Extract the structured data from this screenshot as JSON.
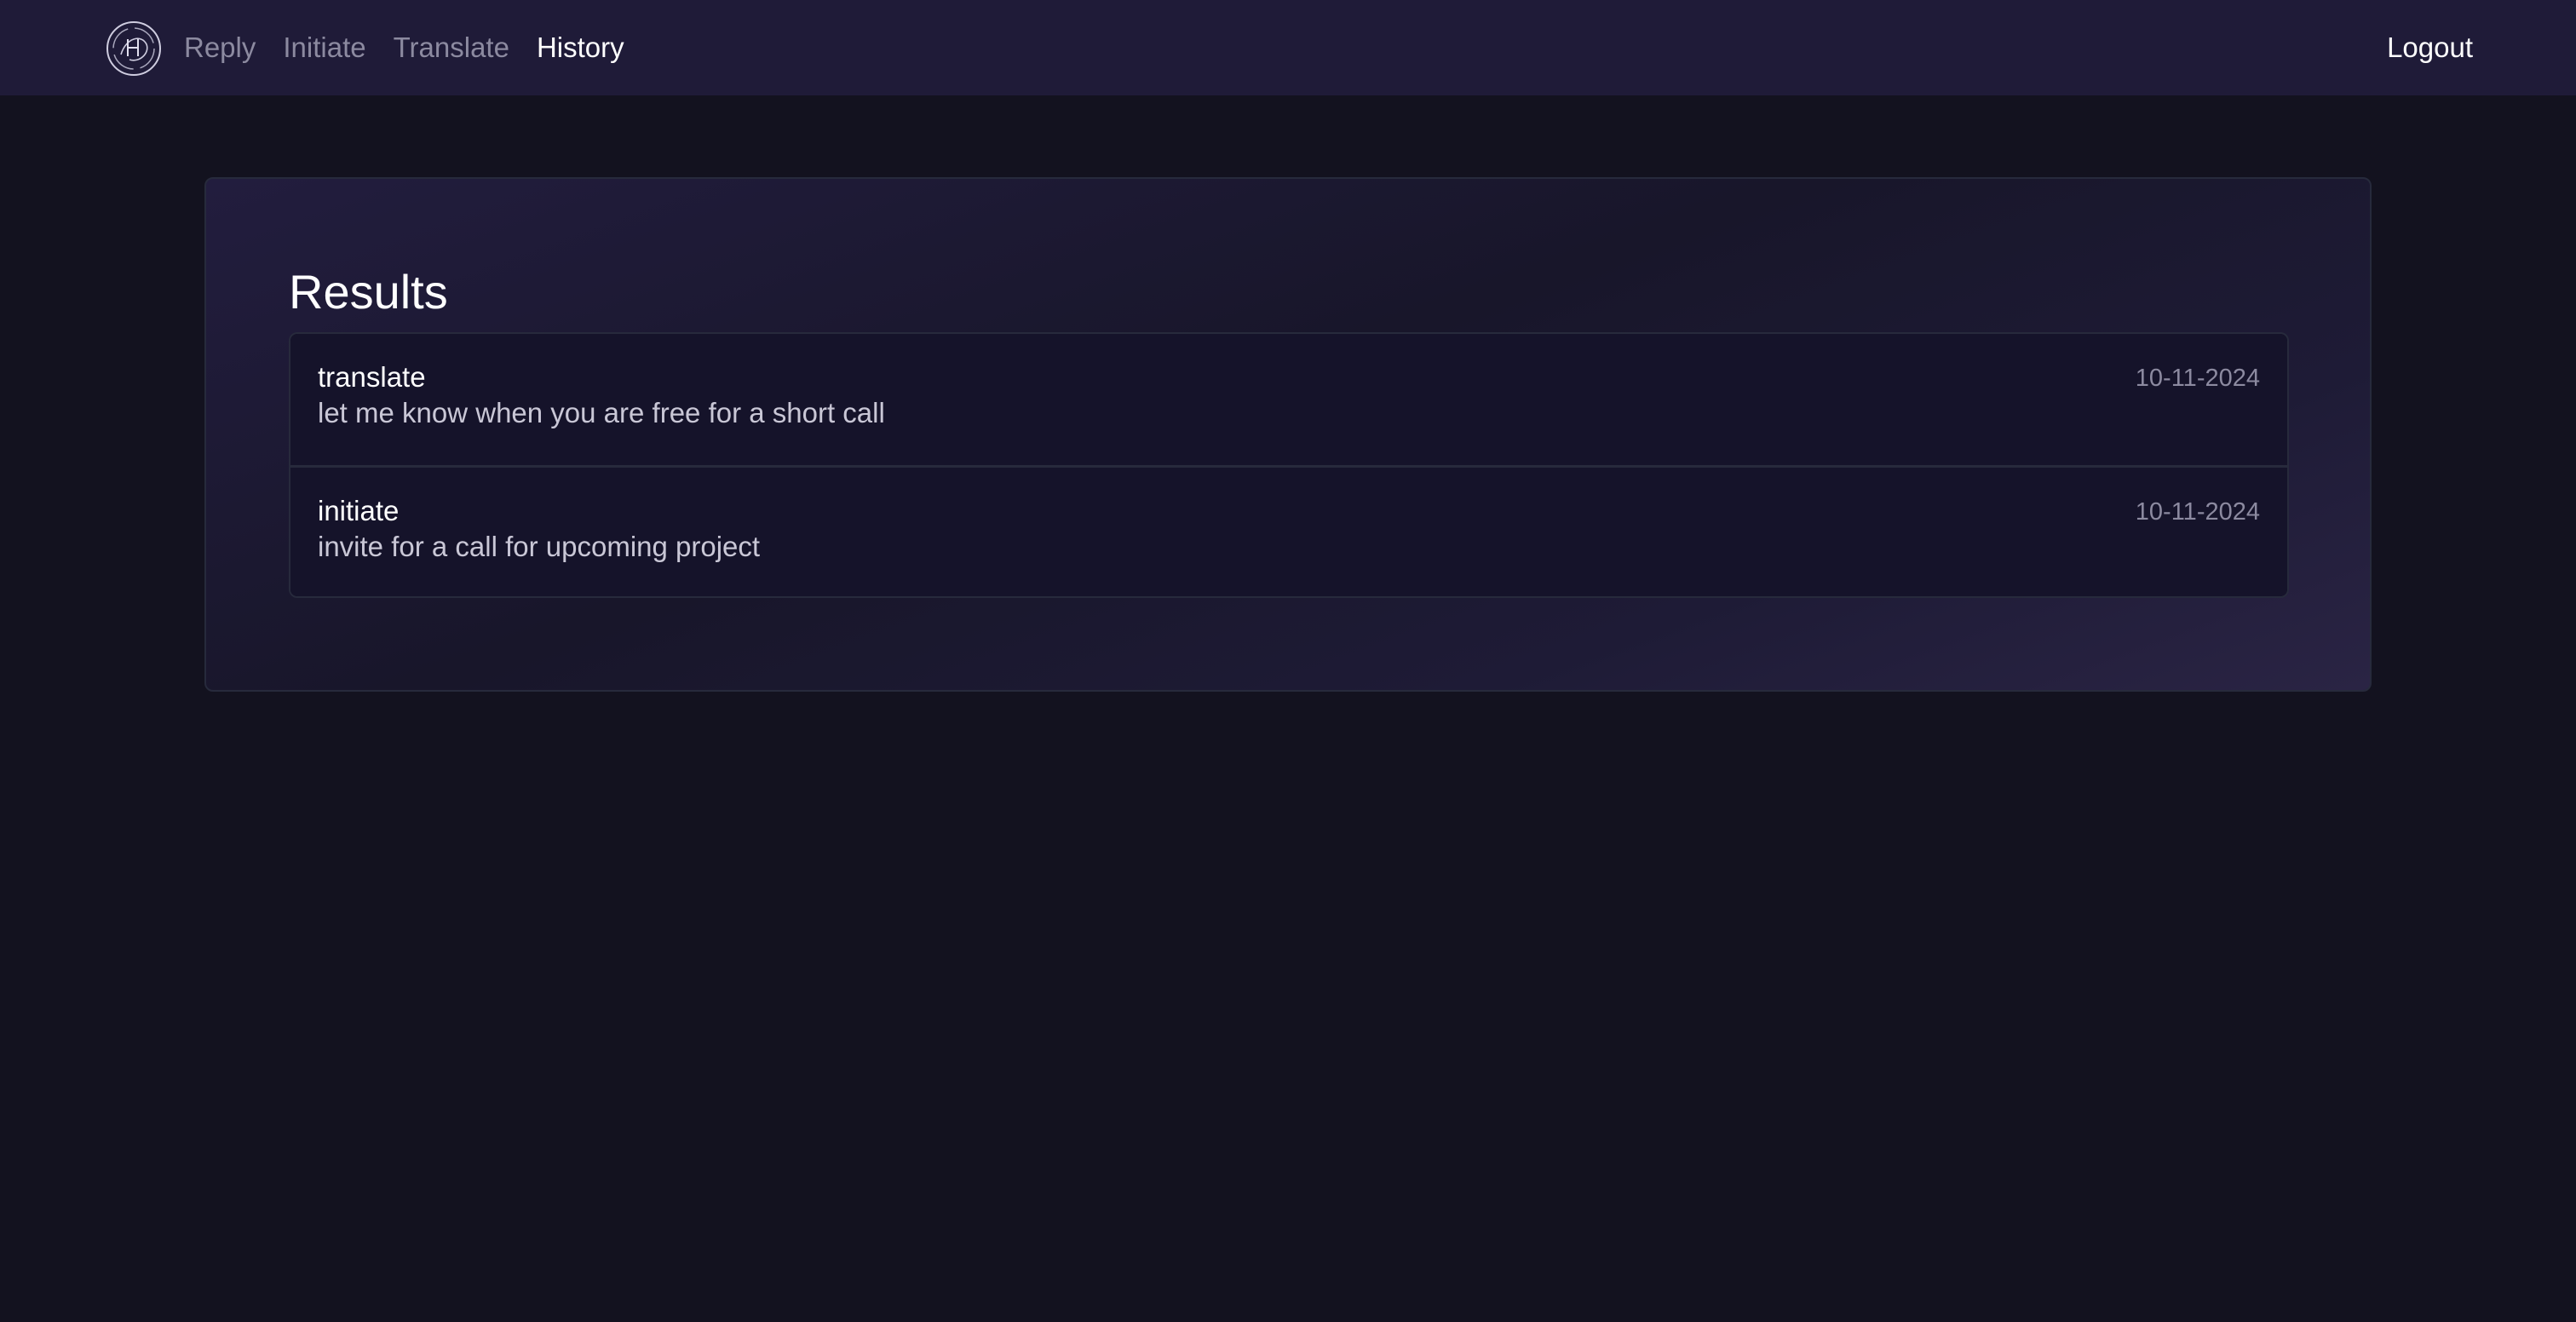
{
  "nav": {
    "links": [
      {
        "label": "Reply"
      },
      {
        "label": "Initiate"
      },
      {
        "label": "Translate"
      },
      {
        "label": "History"
      }
    ],
    "active": "History",
    "logout_label": "Logout",
    "logo_icon": "app-logo-icon"
  },
  "main": {
    "title": "Results",
    "items": [
      {
        "type": "translate",
        "text": "let me know when you are free for a short call",
        "date": "10-11-2024"
      },
      {
        "type": "initiate",
        "text": "invite for a call for upcoming project",
        "date": "10-11-2024"
      }
    ]
  },
  "colors": {
    "background": "#13121f",
    "navbar": "#1f1b38",
    "text_primary": "#ffffff",
    "text_muted": "#8c8aa0"
  }
}
